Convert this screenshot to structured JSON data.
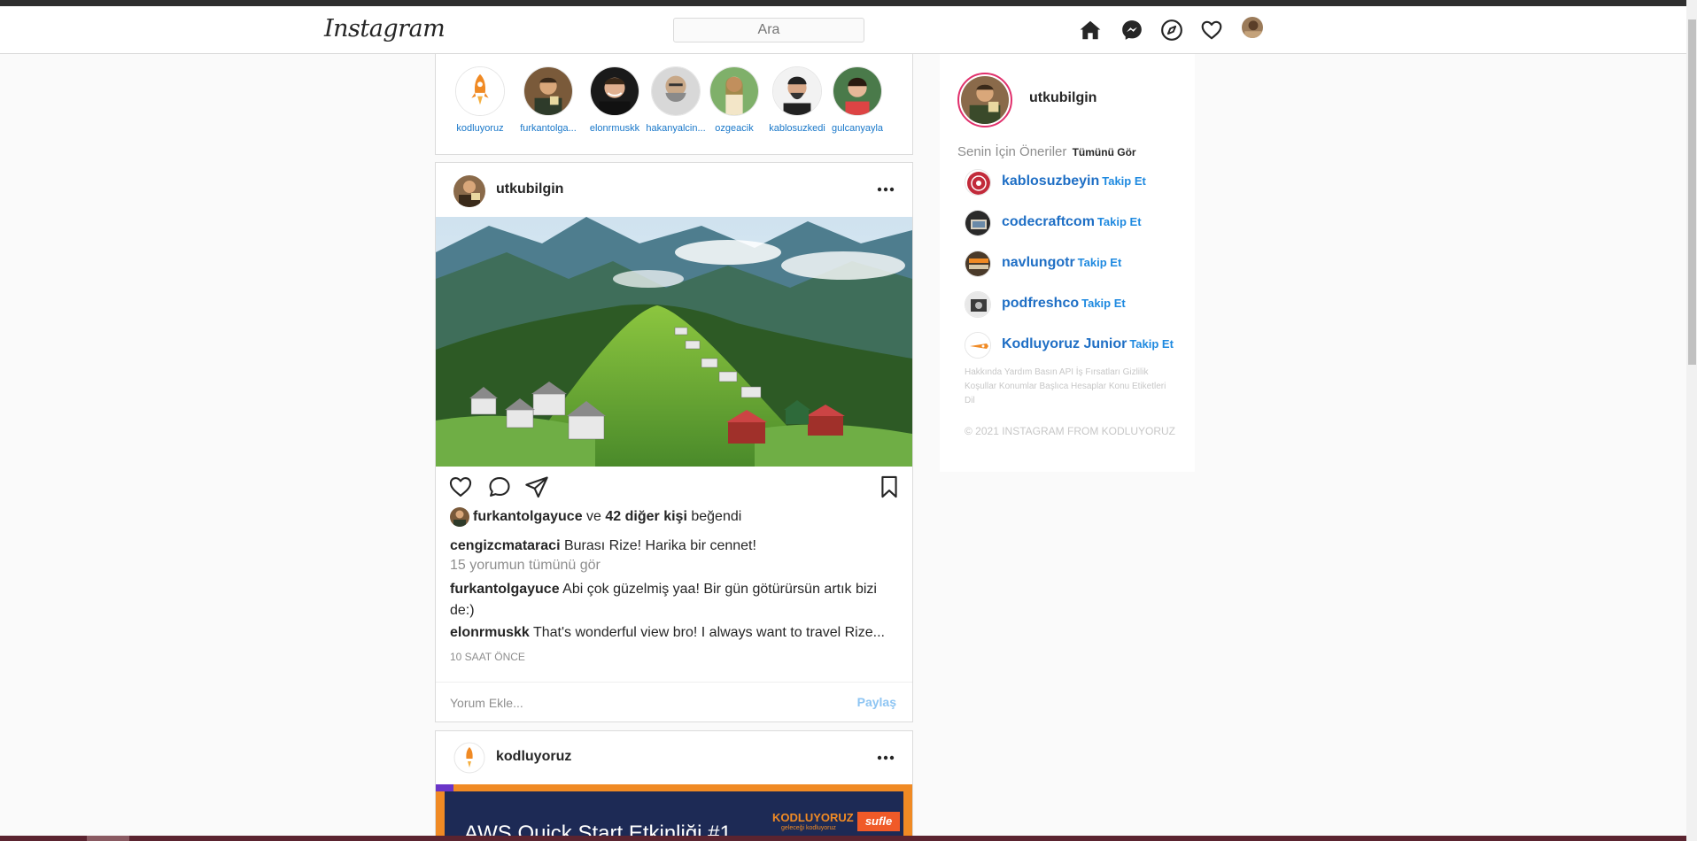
{
  "header": {
    "logo": "Instagram",
    "search_placeholder": "Ara"
  },
  "stories": [
    {
      "name": "kodluyoruz"
    },
    {
      "name": "furkantolga..."
    },
    {
      "name": "elonrmuskk"
    },
    {
      "name": "hakanyalcin..."
    },
    {
      "name": "ozgeacik"
    },
    {
      "name": "kablosuzkedi"
    },
    {
      "name": "gulcanyayla"
    }
  ],
  "post": {
    "username": "utkubilgin",
    "likes": {
      "user": "furkantolgayuce",
      "and": "ve",
      "count": "42 diğer kişi",
      "suffix": "beğendi"
    },
    "caption": {
      "user": "cengizcmataraci",
      "text": "Burası Rize! Harika bir cennet!"
    },
    "view_all": "15 yorumun tümünü gör",
    "comments": [
      {
        "user": "furkantolgayuce",
        "text": "Abi çok güzelmiş yaa! Bir gün götürürsün artık bizi de:)"
      },
      {
        "user": "elonrmuskk",
        "text": "That's wonderful view bro! I always want to travel Rize..."
      }
    ],
    "time": "10 SAAT ÖNCE",
    "comment_placeholder": "Yorum Ekle...",
    "share_label": "Paylaş"
  },
  "post2": {
    "username": "kodluyoruz",
    "banner_title": "AWS Quick Start Etkinliği #1",
    "banner_logo": "KODLUYORUZ",
    "banner_sub": "geleceği kodluyoruz",
    "banner_brand": "sufle"
  },
  "sidebar": {
    "username": "utkubilgin",
    "suggestions_title": "Senin İçin Öneriler",
    "see_all": "Tümünü Gör",
    "suggestions": [
      {
        "name": "kablosuzbeyin",
        "follow": "Takip Et"
      },
      {
        "name": "codecraftcom",
        "follow": "Takip Et"
      },
      {
        "name": "navlungotr",
        "follow": "Takip Et"
      },
      {
        "name": "podfreshco",
        "follow": "Takip Et"
      },
      {
        "name": "Kodluyoruz Junior",
        "follow": "Takip Et"
      }
    ],
    "footer_links": "Hakkında Yardım Basın API İş Fırsatları Gizlilik Koşullar Konumlar Başlıca Hesaplar Konu Etiketleri Dil",
    "copyright": "© 2021 INSTAGRAM FROM KODLUYORUZ"
  },
  "colors": {
    "link_blue": "#1f6fc5",
    "follow_blue": "#1f8ae0",
    "share_blue": "#8ec5f3",
    "story_ring": "#e1306c",
    "banner_orange": "#f08a24",
    "banner_navy": "#1d2a55"
  },
  "icons": {
    "nav": [
      "home-icon",
      "messenger-icon",
      "explore-icon",
      "heart-icon",
      "profile-avatar"
    ],
    "post_actions": [
      "like-icon",
      "comment-icon",
      "share-icon",
      "bookmark-icon"
    ]
  }
}
